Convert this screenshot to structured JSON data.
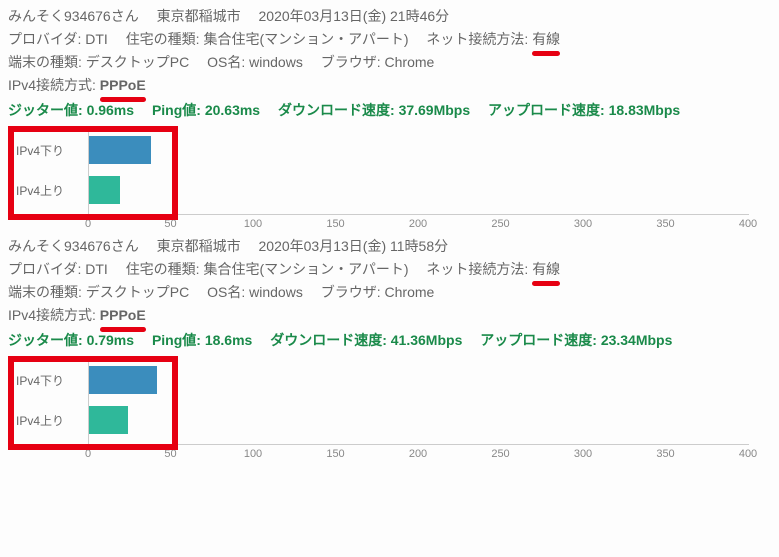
{
  "entries": [
    {
      "header": {
        "user": "みんそく934676さん",
        "location": "東京都稲城市",
        "datetime": "2020年03月13日(金) 21時46分"
      },
      "info": {
        "provider_label": "プロバイダ:",
        "provider": "DTI",
        "house_label": "住宅の種類:",
        "house": "集合住宅(マンション・アパート)",
        "nettype_label": "ネット接続方法:",
        "nettype": "有線",
        "device_label": "端末の種類:",
        "device": "デスクトップPC",
        "os_label": "OS名:",
        "os": "windows",
        "browser_label": "ブラウザ:",
        "browser": "Chrome",
        "ipv4_label": "IPv4接続方式:",
        "ipv4": "PPPoE"
      },
      "stats": {
        "jitter_label": "ジッター値:",
        "jitter": "0.96ms",
        "ping_label": "Ping値:",
        "ping": "20.63ms",
        "down_label": "ダウンロード速度:",
        "down": "37.69Mbps",
        "up_label": "アップロード速度:",
        "up": "18.83Mbps"
      },
      "chart": {
        "down_label": "IPv4下り",
        "up_label": "IPv4上り",
        "down_value": 37.69,
        "up_value": 18.83
      }
    },
    {
      "header": {
        "user": "みんそく934676さん",
        "location": "東京都稲城市",
        "datetime": "2020年03月13日(金) 11時58分"
      },
      "info": {
        "provider_label": "プロバイダ:",
        "provider": "DTI",
        "house_label": "住宅の種類:",
        "house": "集合住宅(マンション・アパート)",
        "nettype_label": "ネット接続方法:",
        "nettype": "有線",
        "device_label": "端末の種類:",
        "device": "デスクトップPC",
        "os_label": "OS名:",
        "os": "windows",
        "browser_label": "ブラウザ:",
        "browser": "Chrome",
        "ipv4_label": "IPv4接続方式:",
        "ipv4": "PPPoE"
      },
      "stats": {
        "jitter_label": "ジッター値:",
        "jitter": "0.79ms",
        "ping_label": "Ping値:",
        "ping": "18.6ms",
        "down_label": "ダウンロード速度:",
        "down": "41.36Mbps",
        "up_label": "アップロード速度:",
        "up": "23.34Mbps"
      },
      "chart": {
        "down_label": "IPv4下り",
        "up_label": "IPv4上り",
        "down_value": 41.36,
        "up_value": 23.34
      }
    }
  ],
  "axis": {
    "min": 0,
    "max": 400,
    "ticks": [
      0,
      50,
      100,
      150,
      200,
      250,
      300,
      350,
      400
    ]
  },
  "chart_data": [
    {
      "type": "bar",
      "orientation": "horizontal",
      "title": "",
      "xlabel": "",
      "ylabel": "",
      "xlim": [
        0,
        400
      ],
      "xticks": [
        0,
        50,
        100,
        150,
        200,
        250,
        300,
        350,
        400
      ],
      "categories": [
        "IPv4下り",
        "IPv4上り"
      ],
      "values": [
        37.69,
        18.83
      ],
      "colors": [
        "#3b8dbd",
        "#2fb89a"
      ]
    },
    {
      "type": "bar",
      "orientation": "horizontal",
      "title": "",
      "xlabel": "",
      "ylabel": "",
      "xlim": [
        0,
        400
      ],
      "xticks": [
        0,
        50,
        100,
        150,
        200,
        250,
        300,
        350,
        400
      ],
      "categories": [
        "IPv4下り",
        "IPv4上り"
      ],
      "values": [
        41.36,
        23.34
      ],
      "colors": [
        "#3b8dbd",
        "#2fb89a"
      ]
    }
  ]
}
